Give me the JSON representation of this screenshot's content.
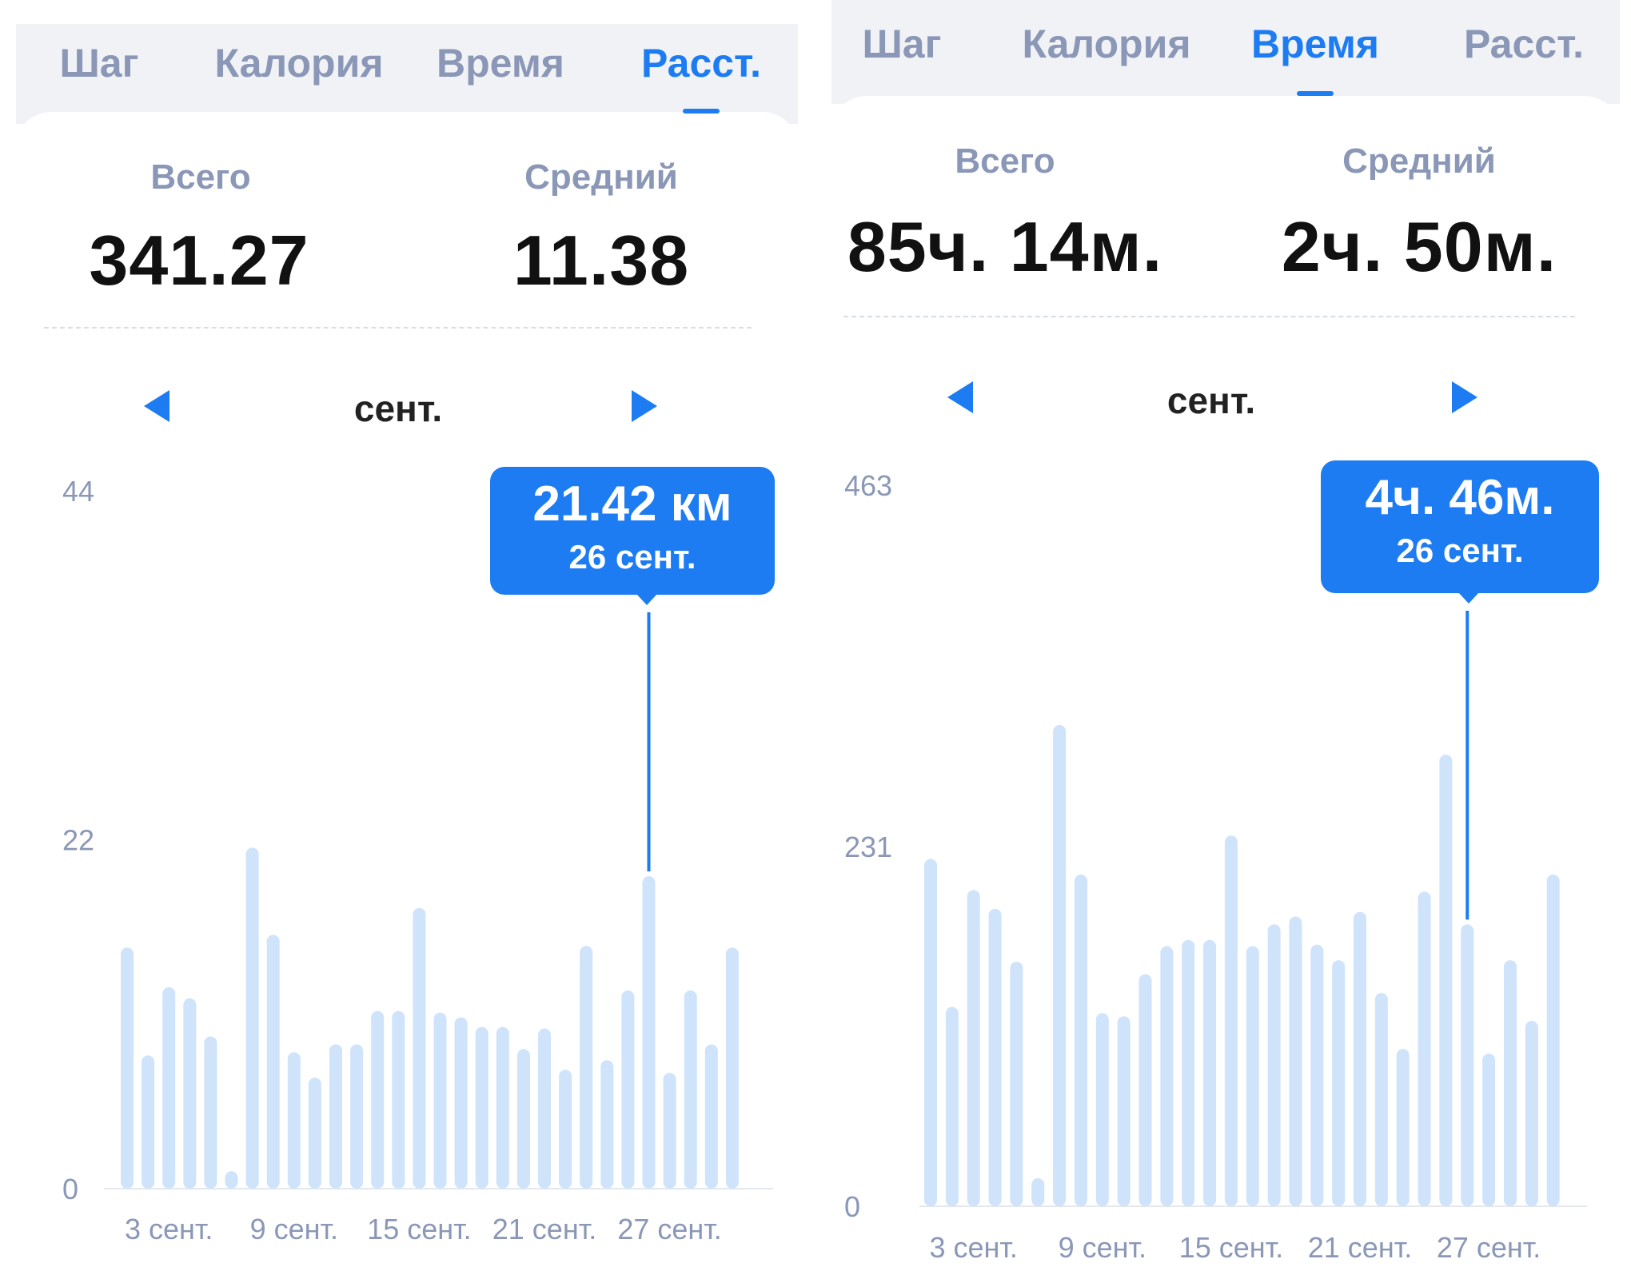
{
  "panels": [
    {
      "tabs": [
        {
          "label": "Шаг",
          "active": false
        },
        {
          "label": "Калория",
          "active": false
        },
        {
          "label": "Время",
          "active": false
        },
        {
          "label": "Расст.",
          "active": true
        }
      ],
      "total_label": "Всего",
      "total_value": "341.27",
      "average_label": "Средний",
      "average_value": "11.38",
      "month": "сент.",
      "tooltip_value": "21.42 км",
      "tooltip_date": "26 сент."
    },
    {
      "tabs": [
        {
          "label": "Шаг",
          "active": false
        },
        {
          "label": "Калория",
          "active": false
        },
        {
          "label": "Время",
          "active": true
        },
        {
          "label": "Расст.",
          "active": false
        }
      ],
      "total_label": "Всего",
      "total_value": "85ч. 14м.",
      "average_label": "Средний",
      "average_value": "2ч. 50м.",
      "month": "сент.",
      "tooltip_value": "4ч. 46м.",
      "tooltip_date": "26 сент."
    }
  ],
  "colors": {
    "accent": "#1d7cf2",
    "bar": "#cfe3fb",
    "muted_text": "#8a97b6",
    "tab_bar_bg": "#f1f2f6"
  },
  "icons": {
    "prev": "triangle-left-icon",
    "next": "triangle-right-icon"
  },
  "chart_data": [
    {
      "type": "bar",
      "categories": [
        "1",
        "2",
        "3",
        "4",
        "5",
        "6",
        "7",
        "8",
        "9",
        "10",
        "11",
        "12",
        "13",
        "14",
        "15",
        "16",
        "17",
        "18",
        "19",
        "20",
        "21",
        "22",
        "23",
        "24",
        "25",
        "26",
        "27",
        "28",
        "29",
        "30"
      ],
      "x_tick_labels": [
        "3 сент.",
        "9 сент.",
        "15 сент.",
        "21 сент.",
        "27 сент."
      ],
      "x_tick_days": [
        3,
        9,
        15,
        21,
        27
      ],
      "values": [
        15.2,
        8.4,
        12.7,
        12.0,
        9.6,
        1.1,
        21.5,
        16.0,
        8.6,
        7.0,
        9.1,
        9.1,
        11.2,
        11.2,
        17.7,
        11.1,
        10.8,
        10.2,
        10.2,
        8.8,
        10.1,
        7.5,
        15.3,
        8.1,
        12.5,
        19.7,
        7.3,
        12.5,
        9.1,
        15.2
      ],
      "y_tick_labels": [
        "0",
        "22",
        "44"
      ],
      "ylim": [
        0,
        44
      ],
      "highlight_index": 25,
      "highlight_line_top": 21.42
    },
    {
      "type": "bar",
      "categories": [
        "1",
        "2",
        "3",
        "4",
        "5",
        "6",
        "7",
        "8",
        "9",
        "10",
        "11",
        "12",
        "13",
        "14",
        "15",
        "16",
        "17",
        "18",
        "19",
        "20",
        "21",
        "22",
        "23",
        "24",
        "25",
        "26",
        "27",
        "28",
        "29",
        "30"
      ],
      "x_tick_labels": [
        "3 сент.",
        "9 сент.",
        "15 сент.",
        "21 сент.",
        "27 сент."
      ],
      "x_tick_days": [
        3,
        9,
        15,
        21,
        27
      ],
      "values": [
        223,
        128,
        203,
        191,
        157,
        18,
        309,
        213,
        124,
        122,
        149,
        167,
        171,
        171,
        238,
        167,
        181,
        186,
        168,
        158,
        189,
        137,
        101,
        202,
        290,
        181,
        98,
        158,
        119,
        213
      ],
      "y_tick_labels": [
        "0",
        "231",
        "463"
      ],
      "ylim": [
        0,
        463
      ],
      "highlight_index": 25,
      "highlight_line_top": 286
    }
  ]
}
